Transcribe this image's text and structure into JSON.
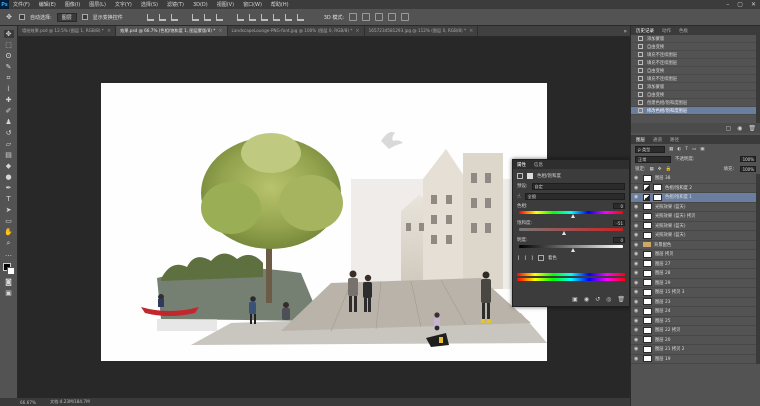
{
  "menu": {
    "app_logo": "Ps",
    "items": [
      "文件(F)",
      "编辑(E)",
      "图像(I)",
      "图层(L)",
      "文字(Y)",
      "选择(S)",
      "滤镜(T)",
      "3D(D)",
      "视图(V)",
      "窗口(W)",
      "帮助(H)"
    ]
  },
  "options": {
    "auto_select_label": "自动选择:",
    "auto_select_value": "图层",
    "transform_label": "显示变换控件"
  },
  "tabs": [
    {
      "label": "墙绘效果.psd @ 12.5% (图层 1, RGB/8) *",
      "active": false
    },
    {
      "label": "效果.psd @ 66.7% (色相/饱和度 1, 图层蒙版/8) *",
      "active": true
    },
    {
      "label": "LandscapeLounge-PNG-font.jpg @ 100% (图层 0, RGB/8) *",
      "active": false
    },
    {
      "label": "1657234581293.jpg @ 112% (图层 0, RGB/8) *",
      "active": false
    }
  ],
  "status": {
    "zoom": "66.67%",
    "doc_size": "文档:4.23M/184.7M"
  },
  "properties": {
    "tab_properties": "属性",
    "tab_info": "信息",
    "title": "色相/饱和度",
    "preset_label": "预设:",
    "preset_value": "自定",
    "channel_value": "全图",
    "hue_label": "色相:",
    "hue_value": "0",
    "saturation_label": "饱和度:",
    "saturation_value": "-51",
    "saturation_fraction": 0.41,
    "lightness_label": "明度:",
    "lightness_value": "0",
    "colorize_label": "着色"
  },
  "history": {
    "tabs": [
      "历史记录",
      "动作",
      "色板"
    ],
    "items": [
      "添加蒙版",
      "自由变换",
      "填充不连续图层",
      "填充不连续图层",
      "自由变换",
      "填充不连续图层",
      "添加蒙版",
      "自由变换",
      "创建色相/饱和度图层",
      "修改色相/饱和度图层"
    ]
  },
  "layers_panel": {
    "tabs": [
      "图层",
      "通道",
      "路径"
    ],
    "filter_label": "ρ 类型",
    "blend_mode": "正常",
    "opacity_label": "不透明度:",
    "opacity_value": "100%",
    "lock_label": "锁定:",
    "fill_label": "填充:",
    "fill_value": "100%",
    "layers": [
      {
        "name": "图层 38",
        "kind": "pixel",
        "selected": false
      },
      {
        "name": "色相/饱和度 2",
        "kind": "adjust",
        "selected": false
      },
      {
        "name": "色相/饱和度 1",
        "kind": "adjust",
        "selected": true
      },
      {
        "name": "光照效果 (蓝天)",
        "kind": "pixel",
        "selected": false
      },
      {
        "name": "光照效果 (蓝天) 拷贝",
        "kind": "pixel",
        "selected": false
      },
      {
        "name": "光照效果 (蓝天)",
        "kind": "pixel",
        "selected": false
      },
      {
        "name": "光照效果 (蓝天)",
        "kind": "pixel",
        "selected": false
      },
      {
        "name": "背景配色",
        "kind": "folder",
        "selected": false
      },
      {
        "name": "图层 拷贝",
        "kind": "pixel",
        "selected": false
      },
      {
        "name": "图层 27",
        "kind": "pixel",
        "selected": false
      },
      {
        "name": "图层 28",
        "kind": "pixel",
        "selected": false
      },
      {
        "name": "图层 29",
        "kind": "pixel",
        "selected": false
      },
      {
        "name": "图层 15 拷贝 3",
        "kind": "pixel",
        "selected": false
      },
      {
        "name": "图层 23",
        "kind": "pixel",
        "selected": false
      },
      {
        "name": "图层 24",
        "kind": "pixel",
        "selected": false
      },
      {
        "name": "图层 25",
        "kind": "pixel",
        "selected": false
      },
      {
        "name": "图层 22 拷贝",
        "kind": "pixel",
        "selected": false
      },
      {
        "name": "图层 20",
        "kind": "pixel",
        "selected": false
      },
      {
        "name": "图层 21 拷贝 2",
        "kind": "pixel",
        "selected": false
      },
      {
        "name": "图层 19",
        "kind": "pixel",
        "selected": false
      }
    ]
  },
  "colors": {
    "app_bg": "#535353",
    "selection": "#6a7ea0",
    "workspace": "#282828"
  }
}
